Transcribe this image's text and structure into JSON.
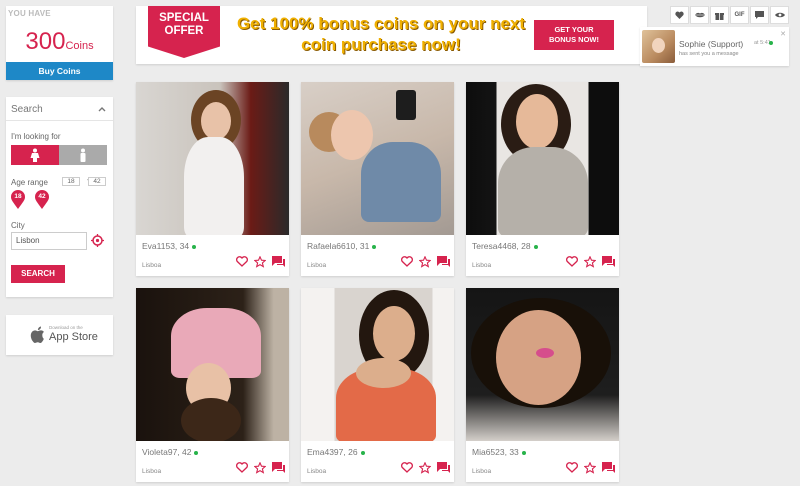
{
  "coins": {
    "you_have": "YOU HAVE",
    "amount": "300",
    "unit": "Coins",
    "buy_label": "Buy Coins"
  },
  "search": {
    "title": "Search",
    "looking_for": "I'm looking for",
    "age_range": "Age range",
    "age_min": "18",
    "age_max": "42",
    "age_dash": "-",
    "pin_min": "18",
    "pin_max": "42",
    "city_label": "City",
    "city_value": "Lisbon",
    "button": "SEARCH"
  },
  "appstore": {
    "small": "Download on the",
    "label": "App Store"
  },
  "banner": {
    "ribbon_line1": "SPECIAL",
    "ribbon_line2": "OFFER",
    "headline_line1": "Get 100% bonus coins on your next",
    "headline_line2": "coin purchase now!",
    "cta_line1": "GET YOUR",
    "cta_line2": "BONUS NOW!"
  },
  "toolbar": {
    "gif_label": "GIF"
  },
  "notification": {
    "name": "Sophie (Support)",
    "time": "at 5:41",
    "message": "has sent you a message",
    "close": "✕"
  },
  "profiles": [
    {
      "name": "Eva1153, 34",
      "city": "Lisboa"
    },
    {
      "name": "Rafaela6610, 31",
      "city": "Lisboa"
    },
    {
      "name": "Teresa4468, 28",
      "city": "Lisboa"
    },
    {
      "name": "Violeta97, 42",
      "city": "Lisboa"
    },
    {
      "name": "Ema4397, 26",
      "city": "Lisboa"
    },
    {
      "name": "Mia6523, 33",
      "city": "Lisboa"
    }
  ],
  "colors": {
    "accent": "#d6234e",
    "buy_blue": "#1e88c7",
    "online": "#27b34a",
    "headline": "#f0b000"
  }
}
